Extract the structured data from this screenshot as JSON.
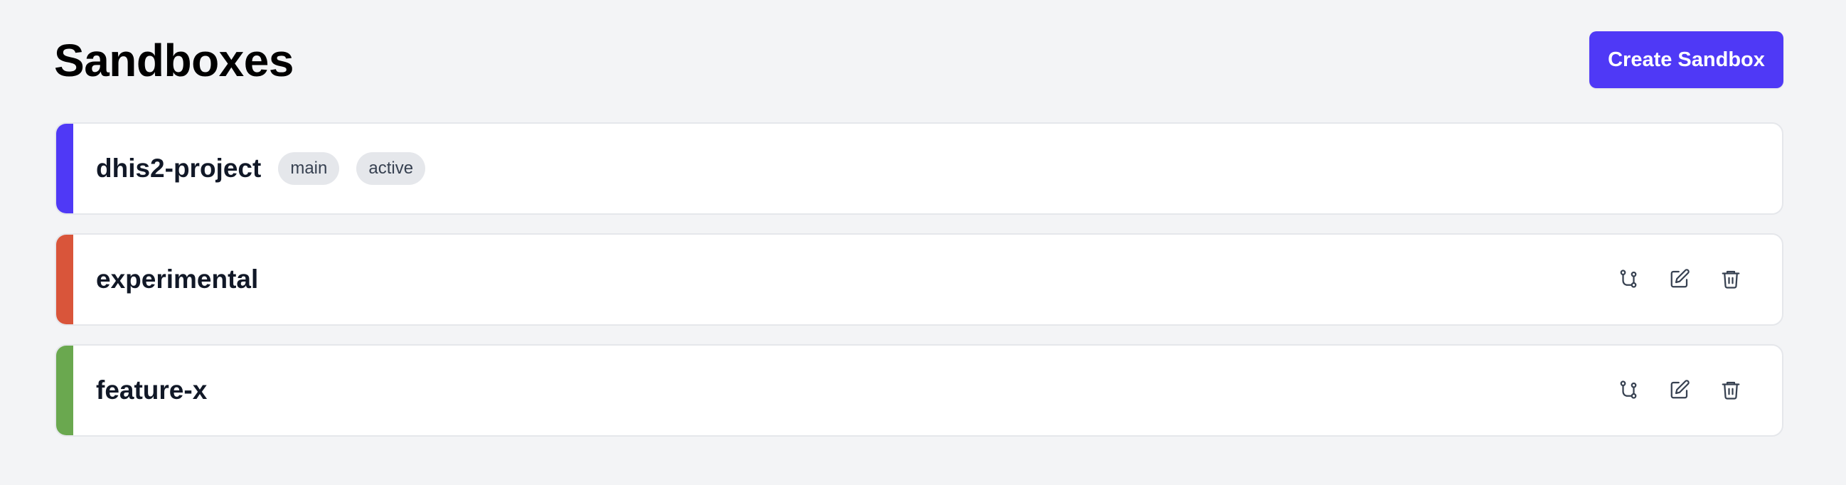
{
  "header": {
    "title": "Sandboxes",
    "create_button_label": "Create Sandbox"
  },
  "colors": {
    "primary": "#4f39f6",
    "background": "#f3f4f6"
  },
  "sandboxes": [
    {
      "name": "dhis2-project",
      "accent_color": "#4f39f6",
      "badges": [
        "main",
        "active"
      ],
      "actions": []
    },
    {
      "name": "experimental",
      "accent_color": "#d9553a",
      "badges": [],
      "actions": [
        "branch-icon",
        "edit-icon",
        "trash-icon"
      ]
    },
    {
      "name": "feature-x",
      "accent_color": "#6aa84f",
      "badges": [],
      "actions": [
        "branch-icon",
        "edit-icon",
        "trash-icon"
      ]
    }
  ]
}
